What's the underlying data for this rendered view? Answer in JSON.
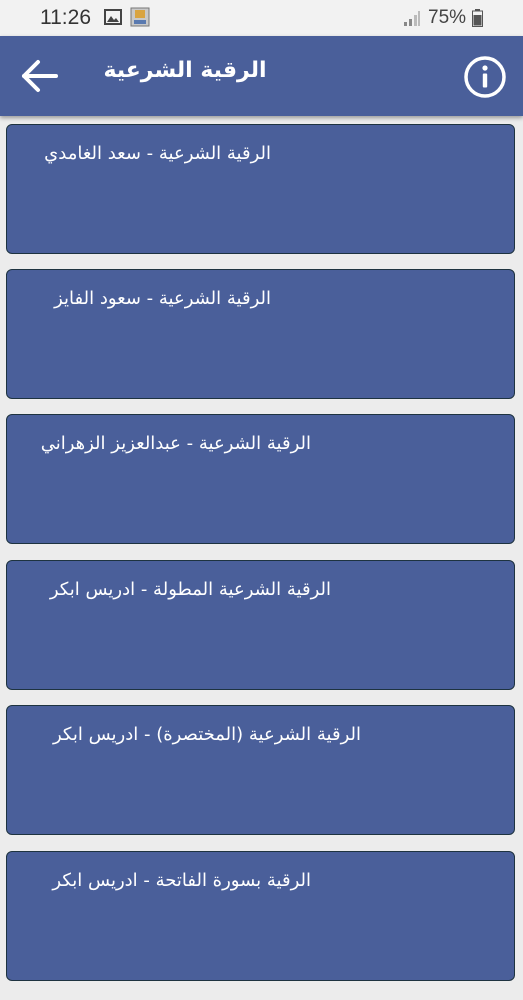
{
  "status_bar": {
    "time": "11:26",
    "battery": "75%"
  },
  "app_bar": {
    "title": "الرقية الشرعية",
    "back_icon": "arrow-left-icon",
    "info_icon": "info-icon"
  },
  "colors": {
    "primary": "#4a5f9a",
    "item_border": "#1e3340",
    "background": "#ececec"
  },
  "list": {
    "items": [
      {
        "label": "الرقية الشرعية - سعد الغامدي"
      },
      {
        "label": "الرقية الشرعية - سعود الفايز"
      },
      {
        "label": "الرقية الشرعية - عبدالعزيز الزهراني"
      },
      {
        "label": "الرقية الشرعية المطولة - ادريس ابكر"
      },
      {
        "label": "الرقية الشرعية (المختصرة) - ادريس ابكر"
      },
      {
        "label": "الرقية بسورة الفاتحة - ادريس ابكر"
      }
    ]
  }
}
